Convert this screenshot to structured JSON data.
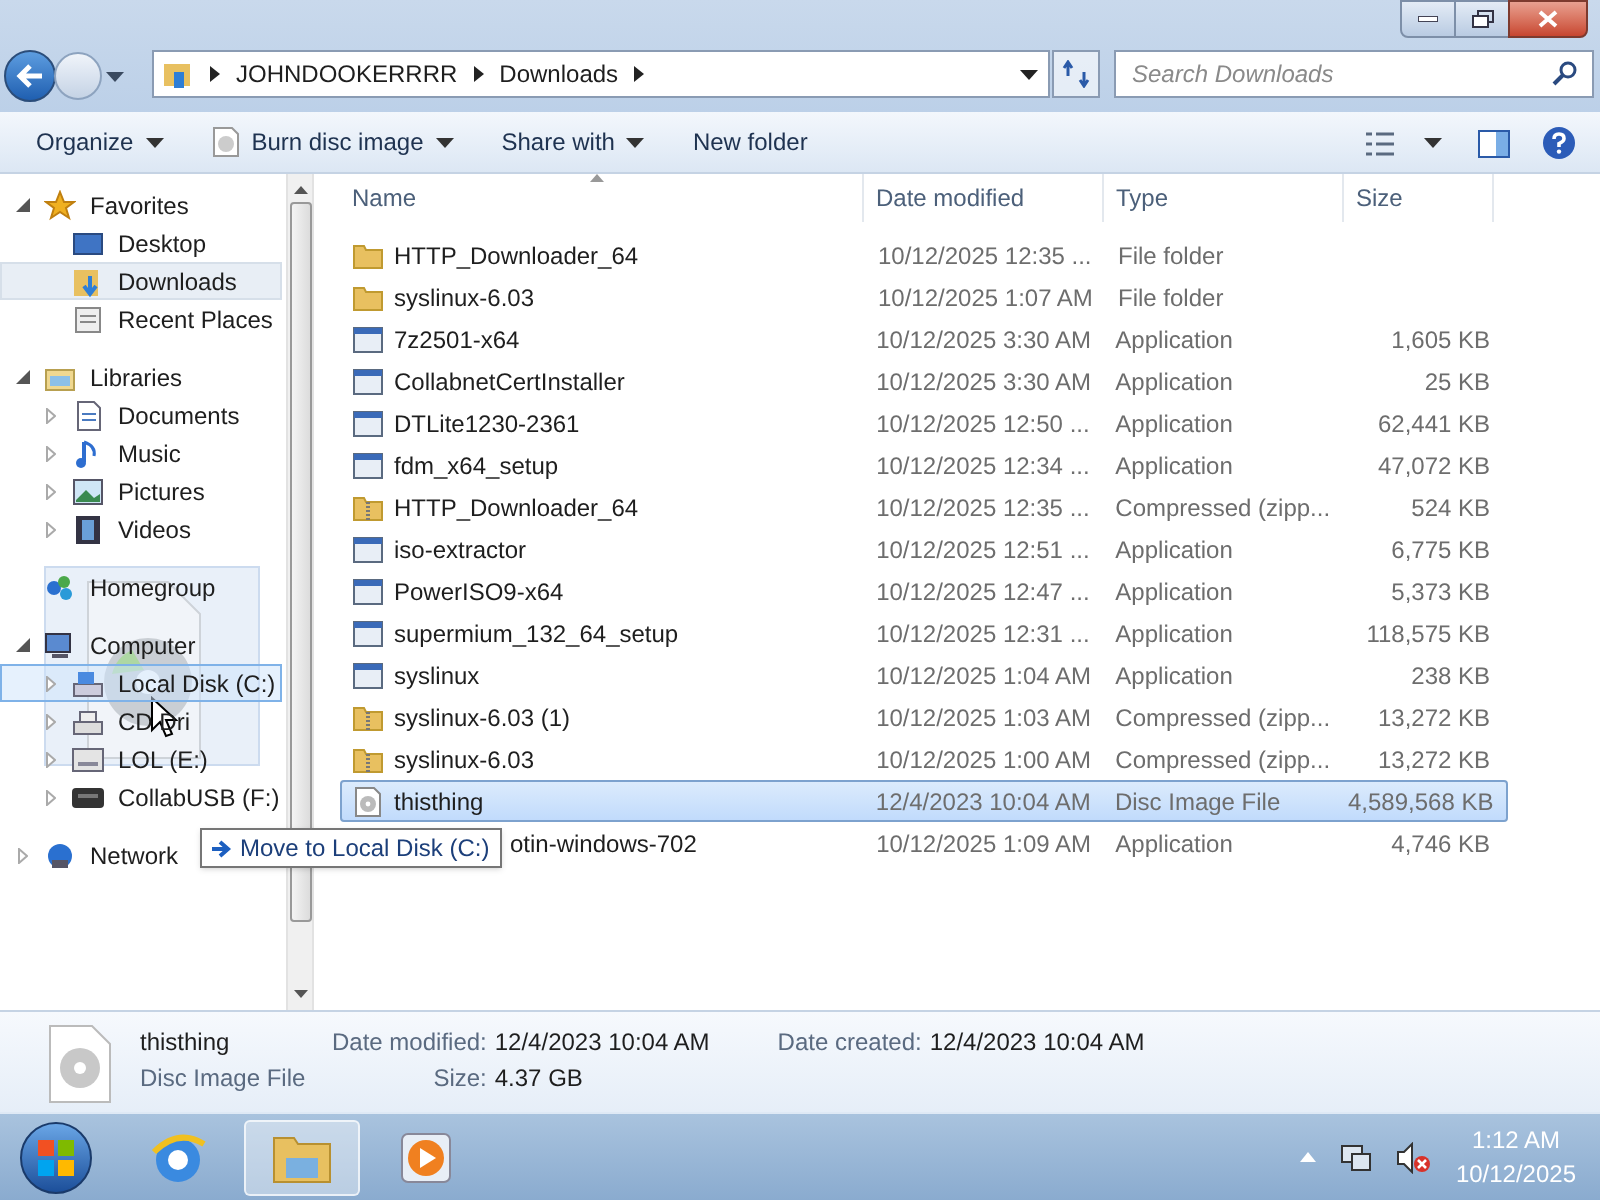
{
  "address_bar": {
    "path": [
      "JOHNDOOKERRRR",
      "Downloads"
    ]
  },
  "search": {
    "placeholder": "Search Downloads"
  },
  "toolbar": [
    {
      "label": "Organize",
      "dropdown": true,
      "kind": "plain"
    },
    {
      "label": "Burn disc image",
      "dropdown": true,
      "kind": "disc"
    },
    {
      "label": "Share with",
      "dropdown": true,
      "kind": "plain"
    },
    {
      "label": "New folder",
      "dropdown": false,
      "kind": "plain"
    }
  ],
  "nav": [
    {
      "label": "Favorites",
      "kind": "star",
      "expanded": true,
      "selected": false,
      "children": [
        {
          "label": "Desktop",
          "kind": "desktop",
          "selected": false
        },
        {
          "label": "Downloads",
          "kind": "downloads",
          "selected": true
        },
        {
          "label": "Recent Places",
          "kind": "recent",
          "selected": false
        }
      ]
    },
    {
      "label": "Libraries",
      "kind": "library",
      "expanded": true,
      "selected": false,
      "children": [
        {
          "label": "Documents",
          "kind": "documents",
          "expanded": false,
          "selected": false
        },
        {
          "label": "Music",
          "kind": "music",
          "expanded": false,
          "selected": false
        },
        {
          "label": "Pictures",
          "kind": "pictures",
          "expanded": false,
          "selected": false
        },
        {
          "label": "Videos",
          "kind": "videos",
          "expanded": false,
          "selected": false
        }
      ]
    },
    {
      "label": "Homegroup",
      "kind": "homegroup",
      "selected": false
    },
    {
      "label": "Computer",
      "kind": "computer",
      "expanded": true,
      "selected": false,
      "children": [
        {
          "label": "Local Disk (C:)",
          "kind": "disk",
          "expanded": false,
          "selected": true
        },
        {
          "label": "CD Dri",
          "kind": "cd",
          "expanded": false,
          "selected": false
        },
        {
          "label": "LOL (E:)",
          "kind": "drive",
          "expanded": false,
          "selected": false
        },
        {
          "label": "CollabUSB (F:)",
          "kind": "usb",
          "expanded": false,
          "selected": false
        }
      ]
    },
    {
      "label": "Network",
      "kind": "network",
      "expanded": false,
      "selected": false
    }
  ],
  "table": {
    "columns": [
      "Name",
      "Date modified",
      "Type",
      "Size"
    ],
    "rows": [
      {
        "name": "HTTP_Downloader_64",
        "date": "10/12/2025 12:35 ...",
        "type": "File folder",
        "size": "",
        "kind": "folder",
        "selected": false
      },
      {
        "name": "syslinux-6.03",
        "date": "10/12/2025 1:07 AM",
        "type": "File folder",
        "size": "",
        "kind": "folder",
        "selected": false
      },
      {
        "name": "7z2501-x64",
        "date": "10/12/2025 3:30 AM",
        "type": "Application",
        "size": "1,605 KB",
        "kind": "app",
        "selected": false
      },
      {
        "name": "CollabnetCertInstaller",
        "date": "10/12/2025 3:30 AM",
        "type": "Application",
        "size": "25 KB",
        "kind": "app",
        "selected": false
      },
      {
        "name": "DTLite1230-2361",
        "date": "10/12/2025 12:50 ...",
        "type": "Application",
        "size": "62,441 KB",
        "kind": "app",
        "selected": false
      },
      {
        "name": "fdm_x64_setup",
        "date": "10/12/2025 12:34 ...",
        "type": "Application",
        "size": "47,072 KB",
        "kind": "app",
        "selected": false
      },
      {
        "name": "HTTP_Downloader_64",
        "date": "10/12/2025 12:35 ...",
        "type": "Compressed (zipp...",
        "size": "524 KB",
        "kind": "zip",
        "selected": false
      },
      {
        "name": "iso-extractor",
        "date": "10/12/2025 12:51 ...",
        "type": "Application",
        "size": "6,775 KB",
        "kind": "app",
        "selected": false
      },
      {
        "name": "PowerISO9-x64",
        "date": "10/12/2025 12:47 ...",
        "type": "Application",
        "size": "5,373 KB",
        "kind": "app",
        "selected": false
      },
      {
        "name": "supermium_132_64_setup",
        "date": "10/12/2025 12:31 ...",
        "type": "Application",
        "size": "118,575 KB",
        "kind": "app",
        "selected": false
      },
      {
        "name": "syslinux",
        "date": "10/12/2025 1:04 AM",
        "type": "Application",
        "size": "238 KB",
        "kind": "app",
        "selected": false
      },
      {
        "name": "syslinux-6.03 (1)",
        "date": "10/12/2025 1:03 AM",
        "type": "Compressed (zipp...",
        "size": "13,272 KB",
        "kind": "zip",
        "selected": false
      },
      {
        "name": "syslinux-6.03",
        "date": "10/12/2025 1:00 AM",
        "type": "Compressed (zipp...",
        "size": "13,272 KB",
        "kind": "zip",
        "selected": false
      },
      {
        "name": "thisthing",
        "date": "12/4/2023 10:04 AM",
        "type": "Disc Image File",
        "size": "4,589,568 KB",
        "kind": "disc",
        "selected": true
      },
      {
        "name": "otin-windows-702",
        "date": "10/12/2025 1:09 AM",
        "type": "Application",
        "size": "4,746 KB",
        "kind": "app",
        "selected": false,
        "partly_covered": true
      }
    ]
  },
  "drag": {
    "tooltip": "Move to Local Disk (C:)"
  },
  "details": {
    "name": "thisthing",
    "type": "Disc Image File",
    "fields": [
      {
        "label": "Date modified:",
        "value": "12/4/2023 10:04 AM"
      },
      {
        "label": "Date created:",
        "value": "12/4/2023 10:04 AM"
      },
      {
        "label": "Size:",
        "value": "4.37 GB"
      }
    ]
  },
  "taskbar": {
    "apps": [
      {
        "kind": "browser",
        "selected": false
      },
      {
        "kind": "explorer",
        "selected": true
      },
      {
        "kind": "media",
        "selected": false
      }
    ],
    "time": "1:12 AM",
    "date": "10/12/2025"
  }
}
